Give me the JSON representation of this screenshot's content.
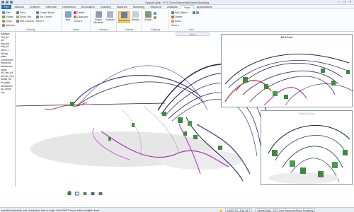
{
  "window": {
    "title": "SpaceCable - PTC Creo Elements/Direct Modeling",
    "ribbon_context_tab": "SpaceCable",
    "controls": [
      "–",
      "□",
      "×"
    ]
  },
  "tabs": [
    "File",
    "Manual",
    "Channel",
    "Interface",
    "Definitions",
    "Annotation",
    "Drawing",
    "Inquiries",
    "Modeling",
    "Structure",
    "Analysis",
    "View",
    "Applications"
  ],
  "active_tab": "View",
  "ribbon": {
    "viewing": {
      "label": "Viewing",
      "items": [
        "Pan",
        "Rotate",
        "Zoom",
        "Window",
        "Fit to...",
        "Show Obj",
        "Edit Camera",
        "Center Mode",
        "Set Center",
        "More"
      ]
    },
    "views": {
      "label": "Views",
      "new_label": "New",
      "items": [
        "Delete",
        "Clipboard",
        "Views"
      ]
    },
    "window_group": {
      "label": "Window",
      "items": [
        "Switch Windows",
        "Toolbars"
      ]
    },
    "feature": {
      "label": "Feature",
      "items": [
        "Advanced",
        "Render"
      ]
    },
    "clipping": {
      "label": "Clipping",
      "items": [
        "Shape"
      ]
    },
    "view_group": {
      "label": "View",
      "items": [
        "Add Object",
        "Delete",
        "Zoom",
        "More"
      ]
    }
  },
  "left_pane": {
    "items": [
      "rkstation",
      "Flat_94",
      "ble",
      "Non-flat",
      "Flat_94",
      "abl01-1",
      "Wiring",
      "ables",
      "Connectors",
      "nnections",
      "cellaneous",
      "ctions",
      "NO-Net_nA",
      "NS-net_Con",
      "Marks_all",
      "nn_parts",
      "rameworks",
      "ng_conds",
      "nce"
    ],
    "selected_index": 5
  },
  "viewport": {
    "tab_label": "view1",
    "insets": [
      {
        "title": "All Lines"
      },
      {
        "title": "SpaceCable"
      }
    ]
  },
  "view_toolbar": [
    "view-mode-1",
    "view-mode-2",
    "view-mode-3",
    "view-mode-4",
    "view-mode-5"
  ],
  "status": {
    "message": "pecialist assembly, part, workplane, face or edge. Hold SHIFT key to select multiple items.",
    "part_label": "HARN-FC_Flat_94 T",
    "mode": "SpaceCable - PTC Creo Elements/Direct Modeling"
  },
  "colors": {
    "accent": "#2e6db4",
    "highlight": "#ffd56b",
    "cable_purple": "#5a3a8a",
    "cable_navy": "#1a1f4d",
    "cable_red": "#c23a3a",
    "cable_magenta": "#b040c0",
    "connector_green": "#3d8a3d"
  }
}
